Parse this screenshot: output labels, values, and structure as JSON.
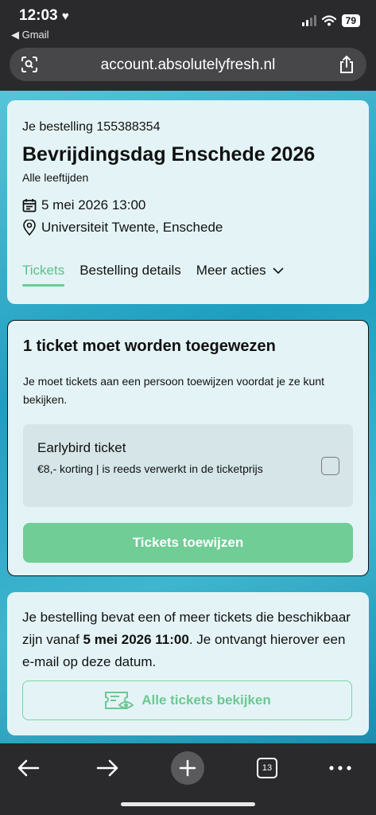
{
  "status_bar": {
    "time": "12:03",
    "back_app": "◀ Gmail",
    "battery": "79"
  },
  "browser": {
    "url": "account.absolutelyfresh.nl",
    "tab_count": "13"
  },
  "order": {
    "order_number": "Je bestelling 155388354",
    "event_title": "Bevrijdingsdag Enschede 2026",
    "age": "Alle leeftijden",
    "date": "5 mei 2026 13:00",
    "location": "Universiteit Twente, Enschede",
    "tabs": [
      {
        "label": "Tickets"
      },
      {
        "label": "Bestelling details"
      },
      {
        "label": "Meer acties"
      }
    ]
  },
  "assign": {
    "title": "1 ticket moet worden toegewezen",
    "description": "Je moet tickets aan een persoon toewijzen voordat je ze kunt bekijken.",
    "ticket_name": "Earlybird ticket",
    "ticket_note": "€8,- korting | is reeds verwerkt in de ticketprijs",
    "button": "Tickets toewijzen"
  },
  "info": {
    "text_before": "Je bestelling bevat een of meer tickets die beschikbaar zijn vanaf ",
    "text_bold": "5 mei 2026 11:00",
    "text_after": ". Je ontvangt hierover een e-mail op deze datum.",
    "button": "Alle tickets bekijken"
  },
  "colors": {
    "accent": "#6fcd95",
    "card_bg": "#e4f4f6",
    "chrome": "#2a2a2c"
  }
}
